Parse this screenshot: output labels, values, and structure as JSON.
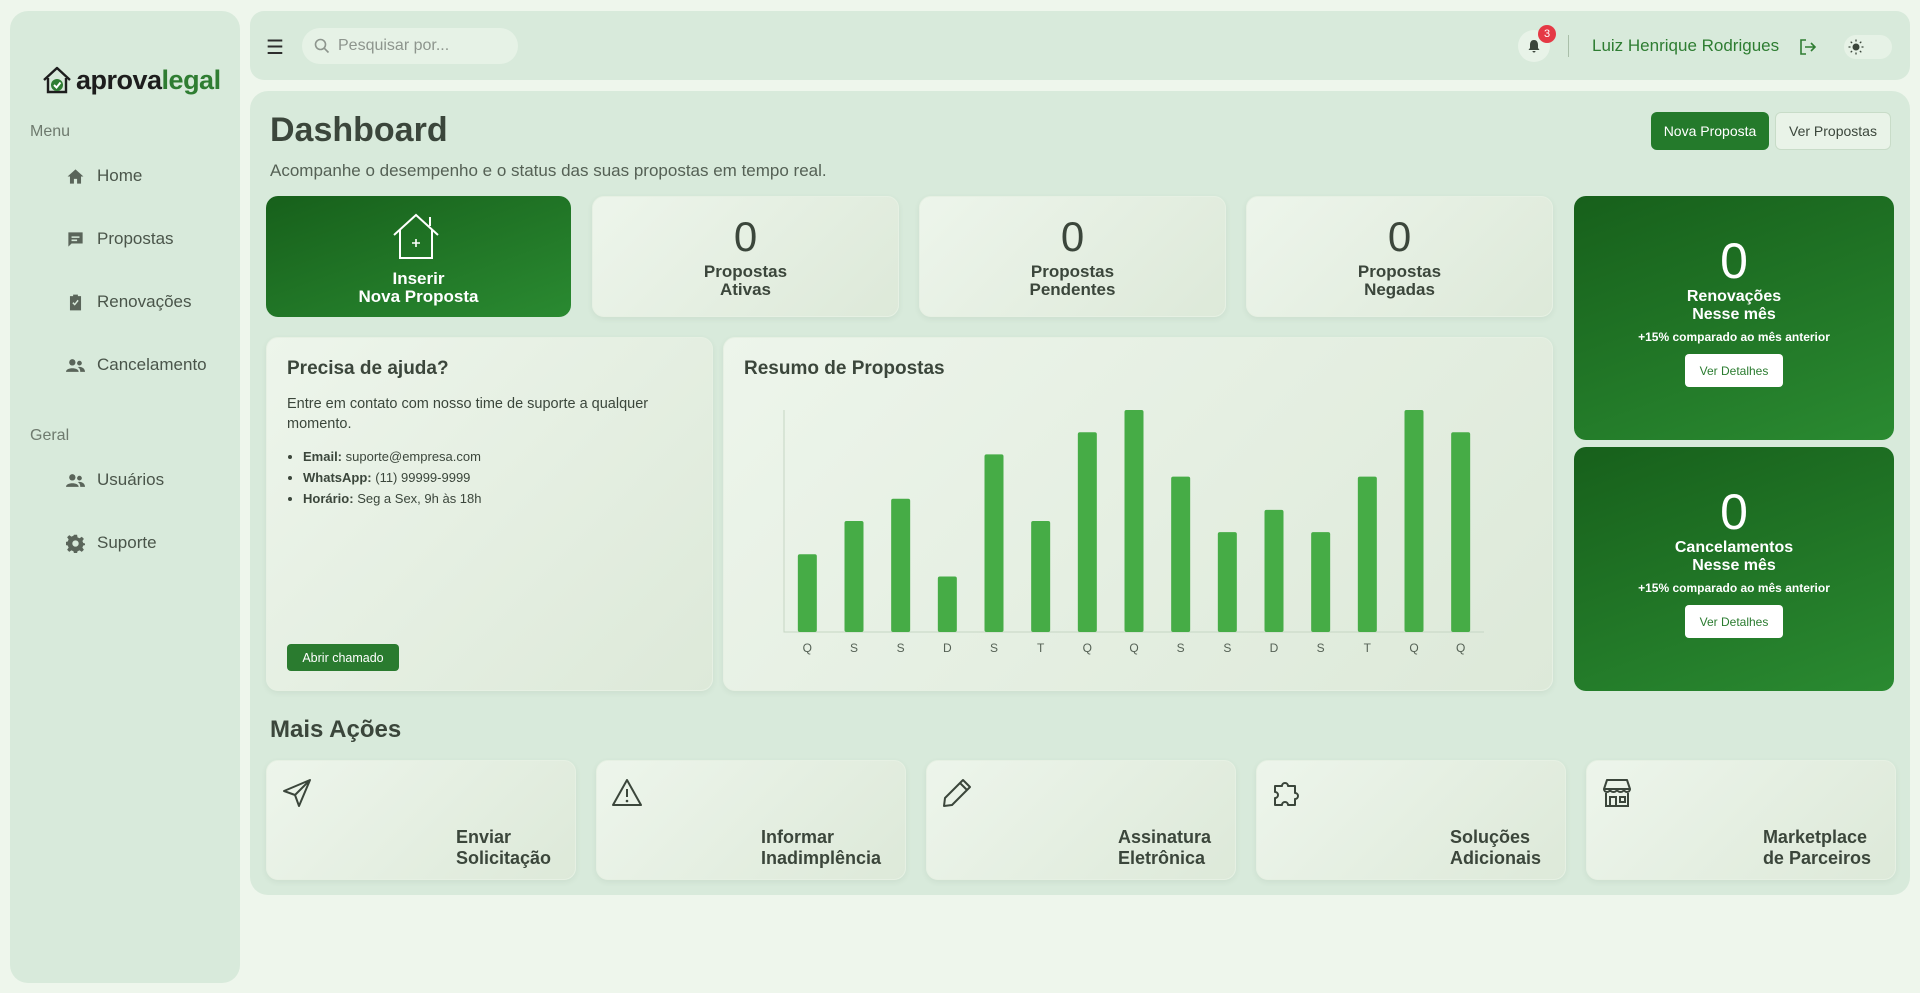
{
  "brand": {
    "logo_part1": "aprova",
    "logo_part2": "legal",
    "accent": "#2f7d32"
  },
  "sidebar": {
    "section_menu": "Menu",
    "menu_items": [
      {
        "label": "Home",
        "icon": "home-icon"
      },
      {
        "label": "Propostas",
        "icon": "message-icon"
      },
      {
        "label": "Renovações",
        "icon": "clipboard-icon"
      },
      {
        "label": "Cancelamento",
        "icon": "users-icon"
      }
    ],
    "section_general": "Geral",
    "general_items": [
      {
        "label": "Usuários",
        "icon": "users-icon"
      },
      {
        "label": "Suporte",
        "icon": "gear-icon"
      }
    ]
  },
  "topbar": {
    "search_placeholder": "Pesquisar por...",
    "notifications_count": "3",
    "user_name": "Luiz Henrique Rodrigues"
  },
  "header": {
    "title": "Dashboard",
    "subtitle": "Acompanhe o desempenho e o status das suas propostas em tempo real.",
    "new_proposal_btn": "Nova Proposta",
    "view_proposals_btn": "Ver Propostas"
  },
  "insert_card": {
    "line1": "Inserir",
    "line2": "Nova Proposta"
  },
  "stats": [
    {
      "value": "0",
      "line1": "Propostas",
      "line2": "Ativas"
    },
    {
      "value": "0",
      "line1": "Propostas",
      "line2": "Pendentes"
    },
    {
      "value": "0",
      "line1": "Propostas",
      "line2": "Negadas"
    }
  ],
  "renewals": {
    "value": "0",
    "line1": "Renovações",
    "line2": "Nesse mês",
    "comparison": "+15% comparado ao mês anterior",
    "button": "Ver Detalhes"
  },
  "cancellations": {
    "value": "0",
    "line1": "Cancelamentos",
    "line2": "Nesse mês",
    "comparison": "+15% comparado ao mês anterior",
    "button": "Ver Detalhes"
  },
  "help": {
    "title": "Precisa de ajuda?",
    "text": "Entre em contato com nosso time de suporte a qualquer momento.",
    "email_label": "Email:",
    "email_value": "suporte@empresa.com",
    "whatsapp_label": "WhatsApp:",
    "whatsapp_value": "(11) 99999-9999",
    "hours_label": "Horário:",
    "hours_value": "Seg a Sex, 9h às 18h",
    "button": "Abrir chamado"
  },
  "chart_data": {
    "type": "bar",
    "title": "Resumo de Propostas",
    "categories": [
      "Q",
      "S",
      "S",
      "D",
      "S",
      "T",
      "Q",
      "Q",
      "S",
      "S",
      "D",
      "S",
      "T",
      "Q",
      "Q"
    ],
    "values": [
      35,
      50,
      60,
      25,
      80,
      50,
      90,
      100,
      70,
      45,
      55,
      45,
      70,
      100,
      90
    ],
    "ylim": [
      0,
      100
    ],
    "bar_color": "#46ac46",
    "grid": false
  },
  "more_actions": {
    "title": "Mais Ações",
    "items": [
      {
        "line1": "Enviar",
        "line2": "Solicitação",
        "icon": "send-icon"
      },
      {
        "line1": "Informar",
        "line2": "Inadimplência",
        "icon": "warning-icon"
      },
      {
        "line1": "Assinatura",
        "line2": "Eletrônica",
        "icon": "pen-icon"
      },
      {
        "line1": "Soluções",
        "line2": "Adicionais",
        "icon": "puzzle-icon"
      },
      {
        "line1": "Marketplace",
        "line2": "de Parceiros",
        "icon": "store-icon"
      }
    ]
  }
}
